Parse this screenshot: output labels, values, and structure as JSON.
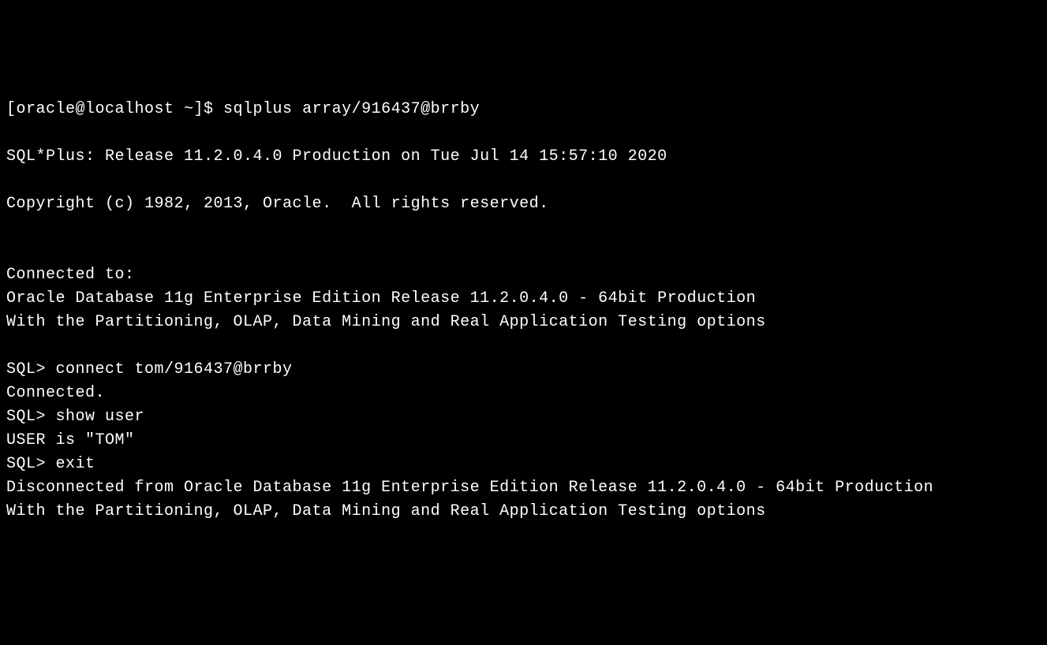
{
  "shell_prompt": "[oracle@localhost ~]$ ",
  "shell_command": "sqlplus array/916437@brrby",
  "blank": "",
  "release_line": "SQL*Plus: Release 11.2.0.4.0 Production on Tue Jul 14 15:57:10 2020",
  "copyright_line": "Copyright (c) 1982, 2013, Oracle.  All rights reserved.",
  "connected_to": "Connected to:",
  "db_line1": "Oracle Database 11g Enterprise Edition Release 11.2.0.4.0 - 64bit Production",
  "db_line2": "With the Partitioning, OLAP, Data Mining and Real Application Testing options",
  "sql_prompt": "SQL> ",
  "cmd_connect": "connect tom/916437@brrby",
  "connected": "Connected.",
  "cmd_show_user": "show user",
  "user_is": "USER is \"TOM\"",
  "cmd_exit": "exit",
  "disconnected_line1": "Disconnected from Oracle Database 11g Enterprise Edition Release 11.2.0.4.0 - 64bit Production",
  "disconnected_line2": "With the Partitioning, OLAP, Data Mining and Real Application Testing options"
}
